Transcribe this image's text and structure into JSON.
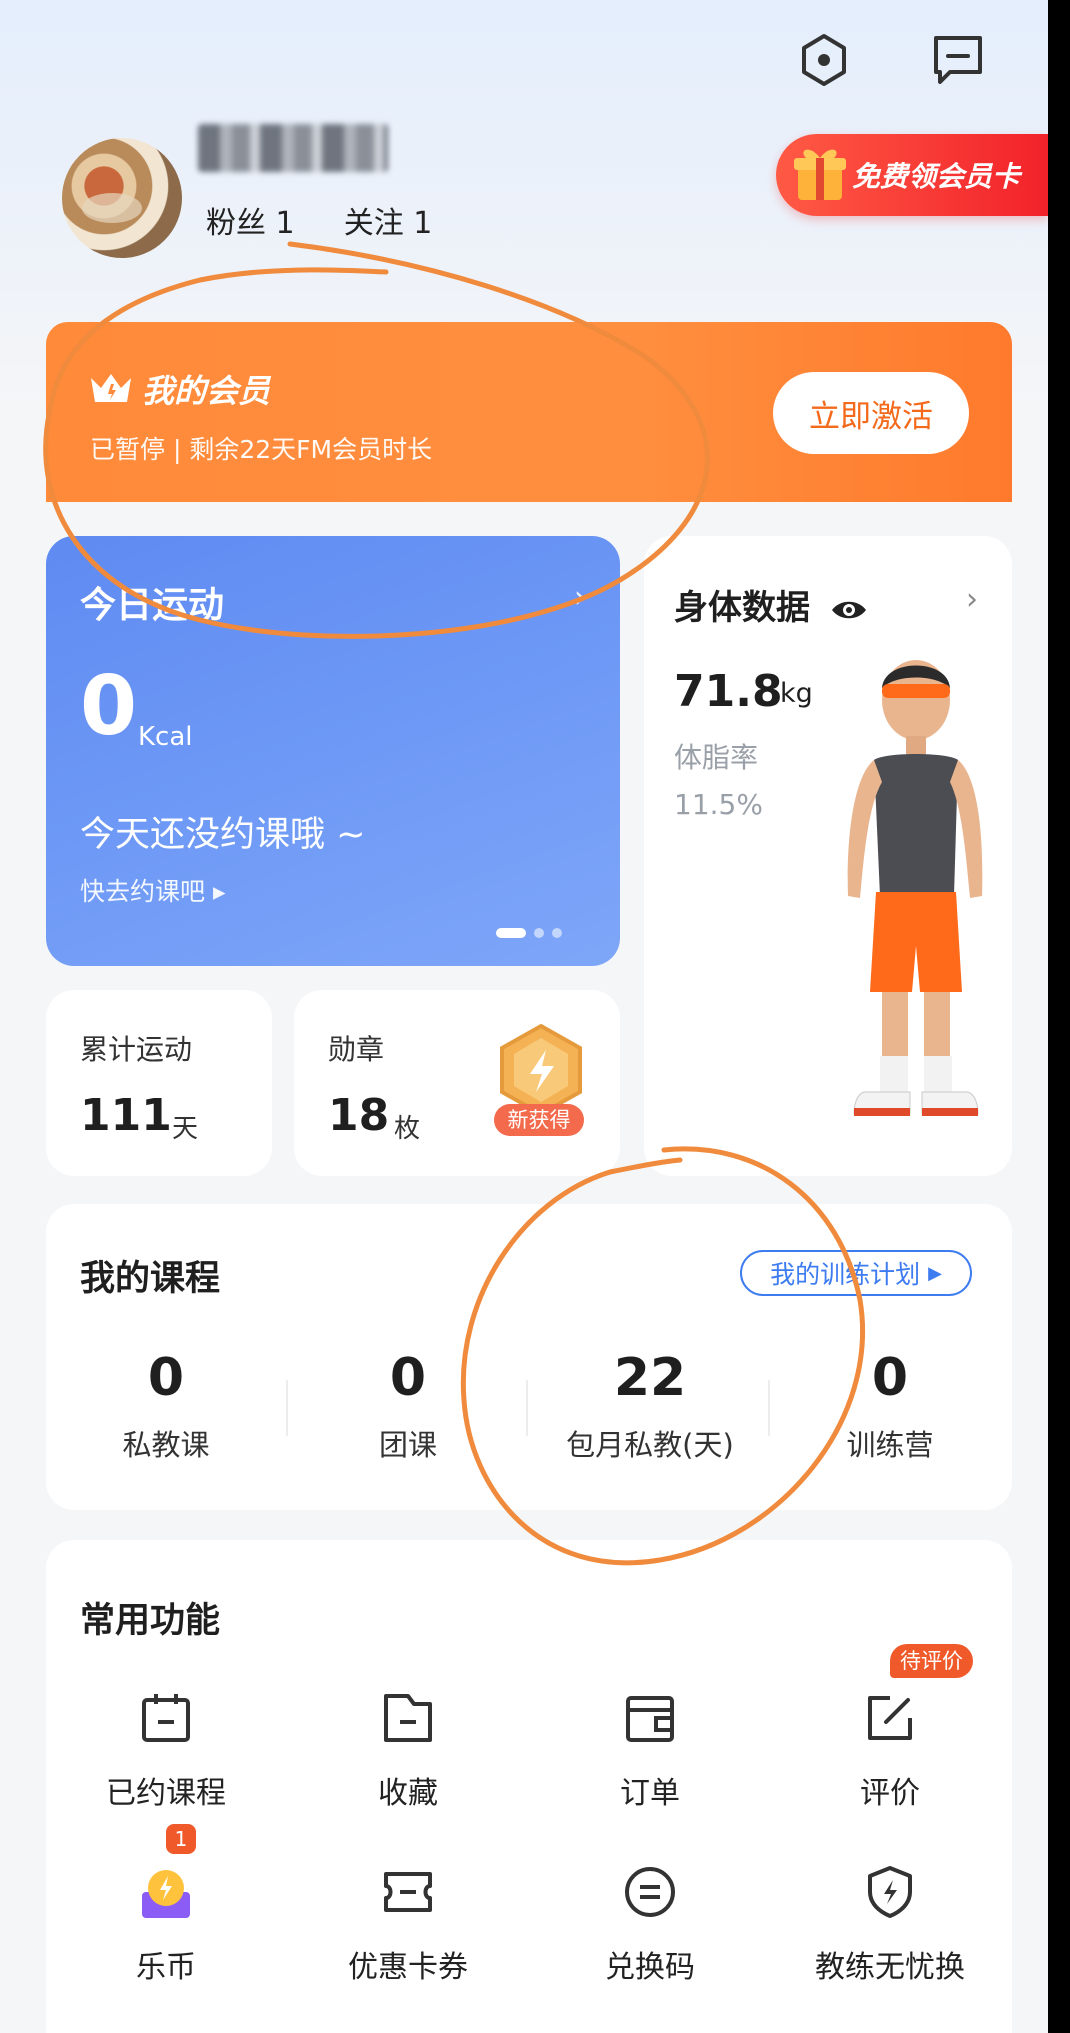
{
  "header": {
    "settings_icon": "hexagon-settings-icon",
    "message_icon": "message-icon"
  },
  "profile": {
    "followers": "粉丝 1",
    "following": "关注 1",
    "free_card_label": "免费领会员卡"
  },
  "membership": {
    "title": "我的会员",
    "status": "已暂停 | 剩余22天FM会员时长",
    "action_label": "立即激活"
  },
  "today_exercise": {
    "title": "今日运动",
    "value": "0",
    "unit": "Kcal",
    "message": "今天还没约课哦 ~",
    "link": "快去约课吧 ▸"
  },
  "body_data": {
    "title": "身体数据",
    "weight": "71.8",
    "weight_unit": "kg",
    "fat_label": "体脂率",
    "fat_value": "11.5%"
  },
  "stats": {
    "total_label": "累计运动",
    "total_value": "111",
    "total_unit": "天",
    "medal_label": "勋章",
    "medal_value": "18",
    "medal_unit": "枚",
    "medal_badge": "新获得"
  },
  "courses": {
    "title": "我的课程",
    "plan_label": "我的训练计划",
    "items": [
      {
        "value": "0",
        "label": "私教课"
      },
      {
        "value": "0",
        "label": "团课"
      },
      {
        "value": "22",
        "label": "包月私教(天)"
      },
      {
        "value": "0",
        "label": "训练营"
      }
    ]
  },
  "functions": {
    "title": "常用功能",
    "pending_review": "待评价",
    "coin_badge": "1",
    "items": [
      {
        "label": "已约课程",
        "icon": "calendar-icon"
      },
      {
        "label": "收藏",
        "icon": "folder-icon"
      },
      {
        "label": "订单",
        "icon": "wallet-icon"
      },
      {
        "label": "评价",
        "icon": "edit-icon"
      },
      {
        "label": "乐币",
        "icon": "coin-icon"
      },
      {
        "label": "优惠卡券",
        "icon": "ticket-icon"
      },
      {
        "label": "兑换码",
        "icon": "redeem-icon"
      },
      {
        "label": "教练无忧换",
        "icon": "shield-icon"
      }
    ]
  },
  "colors": {
    "accent_orange": "#ff8a3a",
    "accent_blue": "#3d7bf0",
    "badge_red": "#f05a2a"
  }
}
